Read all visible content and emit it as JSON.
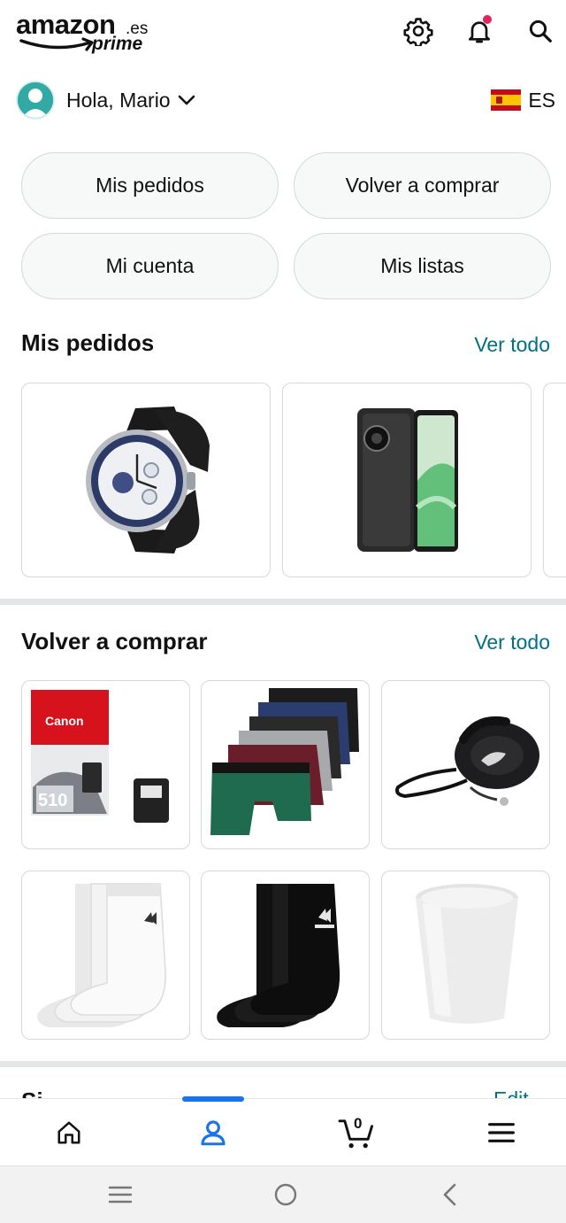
{
  "header": {
    "logo_text": "amazon",
    "logo_tld": ".es",
    "logo_prime": "prime",
    "icons": [
      "gear-icon",
      "bell-icon",
      "search-icon"
    ]
  },
  "greeting": {
    "text": "Hola, Mario",
    "language_code": "ES"
  },
  "quick_links": [
    {
      "label": "Mis pedidos"
    },
    {
      "label": "Volver a comprar"
    },
    {
      "label": "Mi cuenta"
    },
    {
      "label": "Mis listas"
    }
  ],
  "orders_section": {
    "title": "Mis pedidos",
    "link": "Ver todo",
    "items": [
      "smartwatch",
      "phone-case"
    ]
  },
  "buy_again_section": {
    "title": "Volver a comprar",
    "link": "Ver todo",
    "items": [
      "canon-ink-cartridge",
      "boxer-briefs-pack",
      "retractable-dog-leash",
      "white-adidas-socks",
      "black-adidas-socks",
      "plastic-cup"
    ],
    "ink_brand": "Canon",
    "ink_model": "510"
  },
  "next_section_peek": {
    "title": "Si",
    "link": "Edit"
  },
  "bottom_nav": {
    "items": [
      "home-icon",
      "account-icon",
      "cart-icon",
      "menu-icon"
    ],
    "cart_count": "0",
    "active": "account"
  },
  "colors": {
    "link": "#007185",
    "active_nav": "#1a73e8",
    "badge": "#e0245e"
  }
}
